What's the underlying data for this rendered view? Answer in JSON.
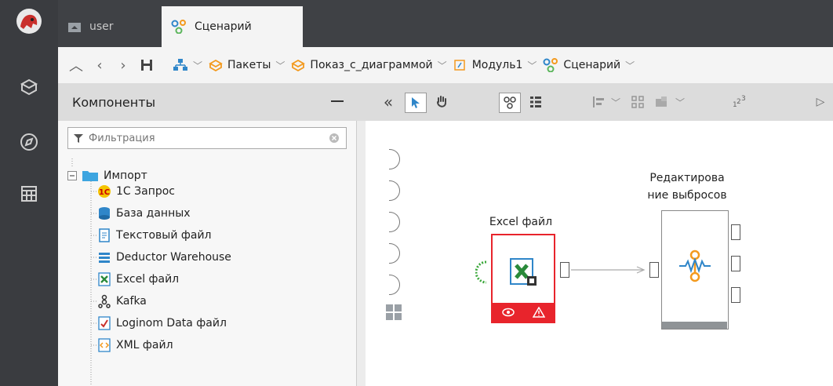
{
  "tabs": [
    {
      "label": "user",
      "icon": "home-icon"
    },
    {
      "label": "Сценарий",
      "icon": "scenario-icon"
    }
  ],
  "breadcrumbs": [
    {
      "label": "",
      "icon": "structure-icon"
    },
    {
      "label": "Пакеты",
      "icon": "package-icon"
    },
    {
      "label": "Показ_с_диаграммой",
      "icon": "package-icon"
    },
    {
      "label": "Модуль1",
      "icon": "module-icon"
    },
    {
      "label": "Сценарий",
      "icon": "scenario-icon"
    }
  ],
  "panel": {
    "title": "Компоненты",
    "filter_placeholder": "Фильтрация",
    "tree": {
      "folder": "Импорт",
      "items": [
        {
          "label": "1С Запрос",
          "icon": "1c-icon"
        },
        {
          "label": "База данных",
          "icon": "database-icon"
        },
        {
          "label": "Текстовый файл",
          "icon": "text-file-icon"
        },
        {
          "label": "Deductor Warehouse",
          "icon": "warehouse-icon"
        },
        {
          "label": "Excel файл",
          "icon": "excel-icon"
        },
        {
          "label": "Kafka",
          "icon": "kafka-icon"
        },
        {
          "label": "Loginom Data файл",
          "icon": "loginom-data-icon"
        },
        {
          "label": "XML файл",
          "icon": "xml-icon"
        }
      ]
    }
  },
  "canvas": {
    "nodes": [
      {
        "label": "Excel файл",
        "state": "error",
        "icon": "excel-icon"
      },
      {
        "label_line1": "Редактирова",
        "label_line2": "ние выбросов",
        "icon": "outlier-edit-icon"
      }
    ]
  },
  "colors": {
    "rail": "#3a3c40",
    "tabbar": "#3f4145",
    "accent_orange": "#f39a1e",
    "error_red": "#e8242c",
    "node_blue": "#2f86c9"
  }
}
